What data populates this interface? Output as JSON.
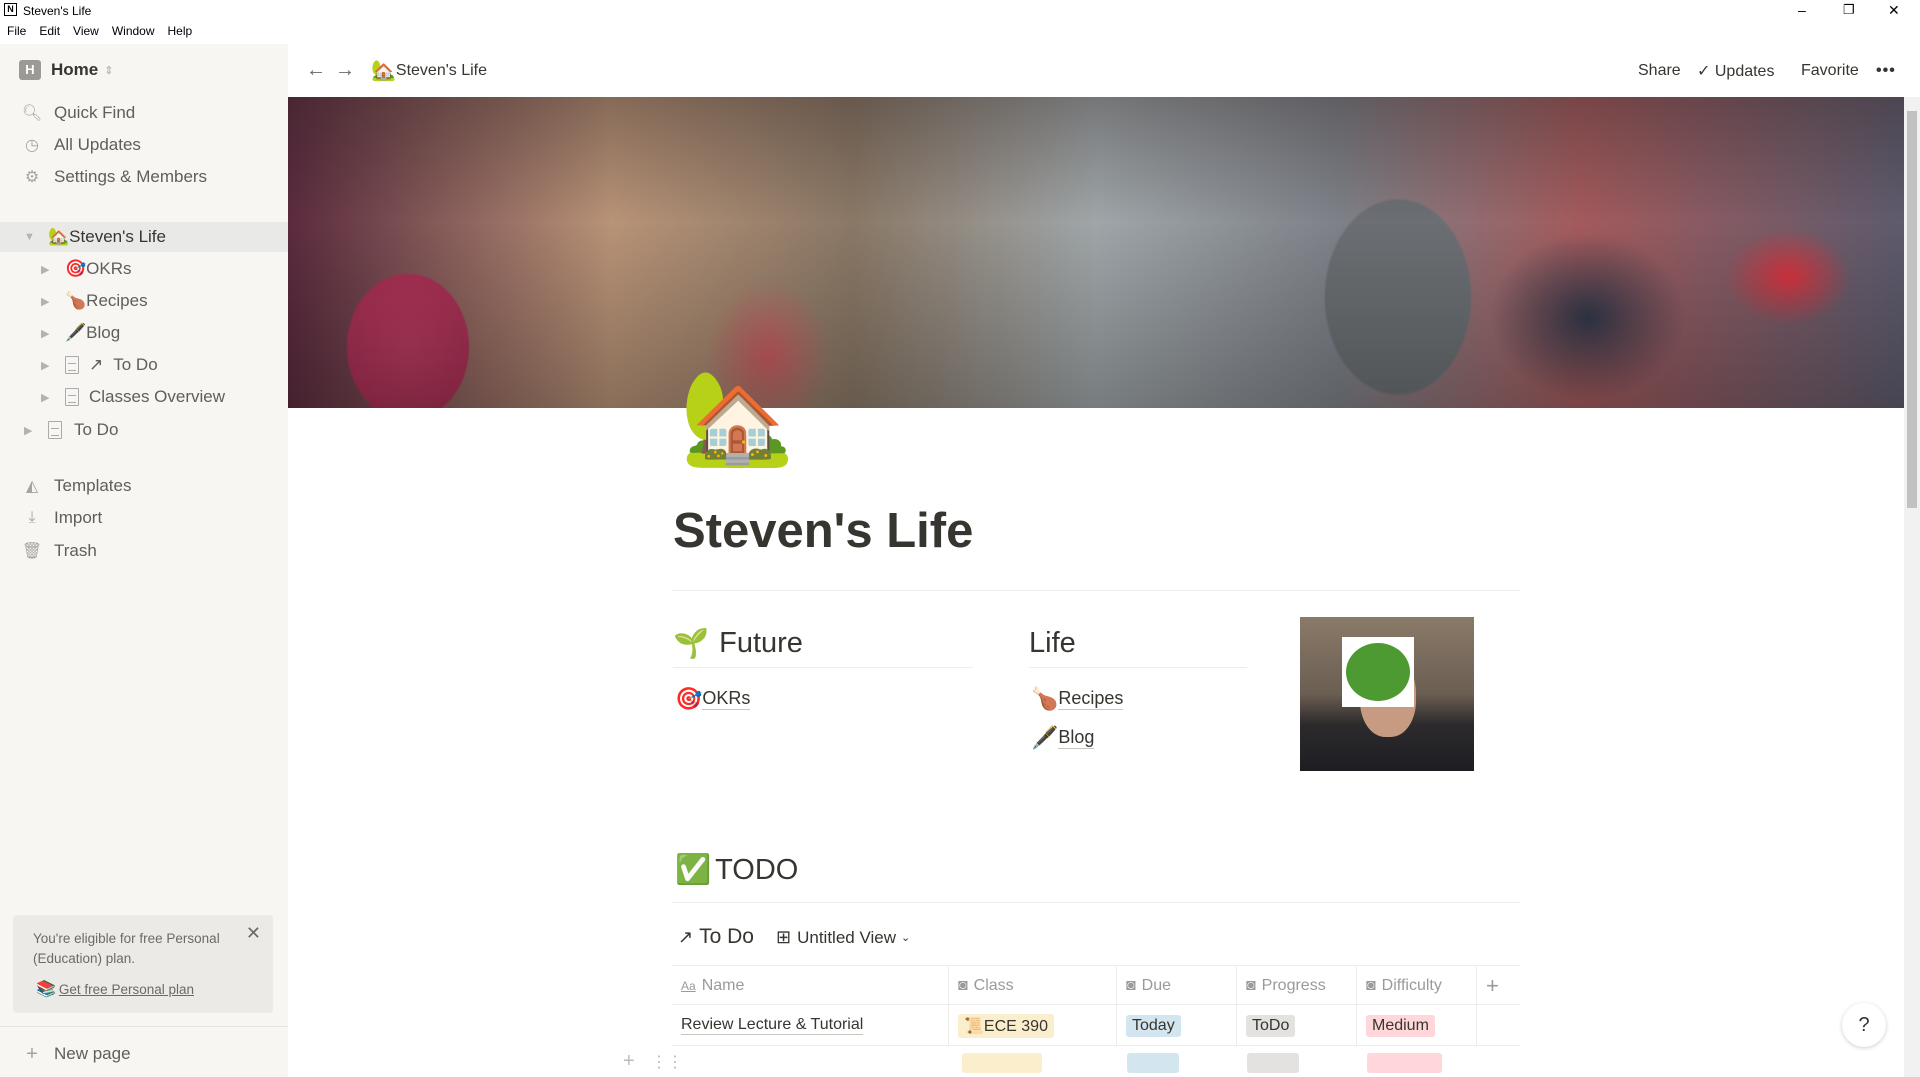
{
  "window": {
    "title": "Steven's Life",
    "menu": [
      "File",
      "Edit",
      "View",
      "Window",
      "Help"
    ],
    "controls": {
      "minimize": "–",
      "maximize": "❐",
      "close": "✕"
    }
  },
  "sidebar": {
    "workspace": {
      "initial": "H",
      "name": "Home"
    },
    "nav": [
      {
        "label": "Quick Find",
        "icon": "search-icon"
      },
      {
        "label": "All Updates",
        "icon": "clock-icon"
      },
      {
        "label": "Settings & Members",
        "icon": "gear-icon"
      }
    ],
    "tree": [
      {
        "label": "Steven's Life",
        "emoji": "🏡",
        "level": 0,
        "expanded": true
      },
      {
        "label": "OKRs",
        "emoji": "🎯",
        "level": 1
      },
      {
        "label": "Recipes",
        "emoji": "🍗",
        "level": 1
      },
      {
        "label": "Blog",
        "emoji": "🖋️",
        "level": 1
      },
      {
        "label": "To Do",
        "prefix": "↗",
        "level": 1,
        "icon": "page-icon"
      },
      {
        "label": "Classes Overview",
        "level": 1,
        "icon": "page-icon"
      },
      {
        "label": "To Do",
        "level": 0,
        "icon": "page-icon"
      }
    ],
    "bottom": [
      {
        "label": "Templates",
        "icon": "templates-icon"
      },
      {
        "label": "Import",
        "icon": "import-icon"
      },
      {
        "label": "Trash",
        "icon": "trash-icon"
      }
    ],
    "promo": {
      "text": "You're eligible for free Personal (Education) plan.",
      "link": "Get free Personal plan"
    },
    "new_page": "New page"
  },
  "header": {
    "breadcrumb": "Steven's Life",
    "breadcrumb_emoji": "🏡",
    "share": "Share",
    "updates": "Updates",
    "favorite": "Favorite",
    "more": "•••"
  },
  "page": {
    "icon": "🏡",
    "title": "Steven's Life",
    "columns": [
      {
        "heading": "Future",
        "emoji": "🌱",
        "links": [
          {
            "emoji": "🎯",
            "label": "OKRs"
          }
        ]
      },
      {
        "heading": "Life",
        "links": [
          {
            "emoji": "🍗",
            "label": "Recipes"
          },
          {
            "emoji": "🖋️",
            "label": "Blog"
          }
        ]
      }
    ],
    "todo_heading": "TODO",
    "todo_emoji": "✅",
    "db": {
      "link_arrow": "↗",
      "title": "To Do",
      "view": "Untitled View",
      "columns": [
        "Name",
        "Class",
        "Due",
        "Progress",
        "Difficulty"
      ],
      "rows": [
        {
          "name": "Review Lecture & Tutorial",
          "class": "ECE 390",
          "due": "Today",
          "progress": "ToDo",
          "difficulty": "Medium"
        }
      ],
      "colors": {
        "class": "#fbeecc",
        "due": "#d3e5ef",
        "progress": "#e3e2e0",
        "difficulty": "#ffd6d9"
      }
    }
  },
  "help": "?"
}
